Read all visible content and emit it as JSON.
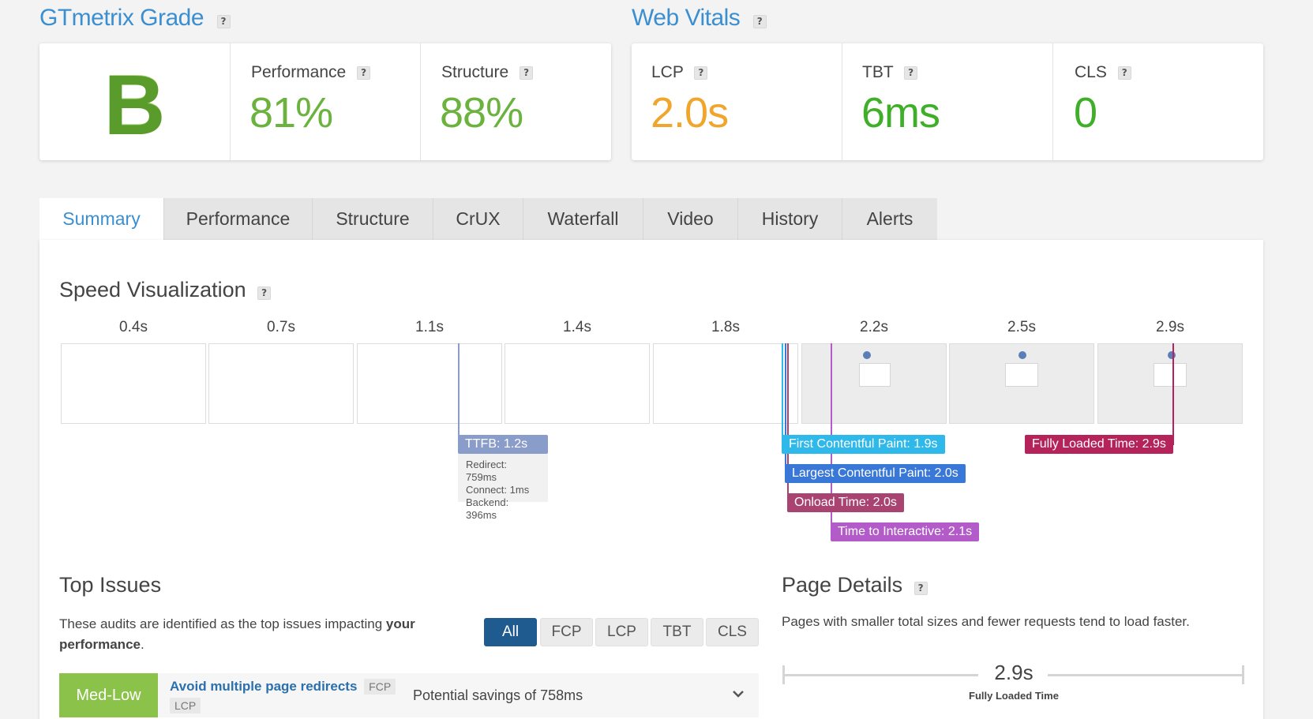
{
  "grade_section": {
    "title": "GTmetrix Grade",
    "help": "?",
    "grade": "B",
    "performance_label": "Performance",
    "performance_value": "81%",
    "structure_label": "Structure",
    "structure_value": "88%"
  },
  "vitals_section": {
    "title": "Web Vitals",
    "help": "?",
    "lcp_label": "LCP",
    "lcp_value": "2.0s",
    "tbt_label": "TBT",
    "tbt_value": "6ms",
    "cls_label": "CLS",
    "cls_value": "0"
  },
  "colors": {
    "accent": "#3b8fd0",
    "green": "#6bb33e",
    "orange": "#f0a52c",
    "dark_green": "#3fae29",
    "ttfb": "#8a9cc9",
    "fcp": "#2fb8ea",
    "lcp": "#3a78d8",
    "onload": "#a94472",
    "tti": "#b35cc9",
    "fully_loaded": "#b4235a"
  },
  "tabs": [
    "Summary",
    "Performance",
    "Structure",
    "CrUX",
    "Waterfall",
    "Video",
    "History",
    "Alerts"
  ],
  "active_tab": "Summary",
  "speed_viz": {
    "title": "Speed Visualization",
    "help": "?",
    "ticks": [
      "0.4s",
      "0.7s",
      "1.1s",
      "1.4s",
      "1.8s",
      "2.2s",
      "2.5s",
      "2.9s"
    ],
    "markers": {
      "ttfb": "TTFB: 1.2s",
      "ttfb_redirect": "Redirect: 759ms",
      "ttfb_connect": "Connect: 1ms",
      "ttfb_backend": "Backend: 396ms",
      "fcp": "First Contentful Paint: 1.9s",
      "lcp": "Largest Contentful Paint: 2.0s",
      "onload": "Onload Time: 2.0s",
      "tti": "Time to Interactive: 2.1s",
      "fully_loaded": "Fully Loaded Time: 2.9s"
    }
  },
  "top_issues": {
    "title": "Top Issues",
    "description_plain": "These audits are identified as the top issues impacting ",
    "description_bold1": "your",
    "description_bold2": "performance",
    "description_end": ".",
    "filters": [
      "All",
      "FCP",
      "LCP",
      "TBT",
      "CLS"
    ],
    "active_filter": "All",
    "issue": {
      "severity": "Med-Low",
      "title": "Avoid multiple page redirects",
      "tag1": "FCP",
      "tag2": "LCP",
      "savings": "Potential savings of 758ms"
    }
  },
  "page_details": {
    "title": "Page Details",
    "help": "?",
    "description": "Pages with smaller total sizes and fewer requests tend to load faster.",
    "fully_loaded_value": "2.9s",
    "fully_loaded_label": "Fully Loaded Time"
  }
}
